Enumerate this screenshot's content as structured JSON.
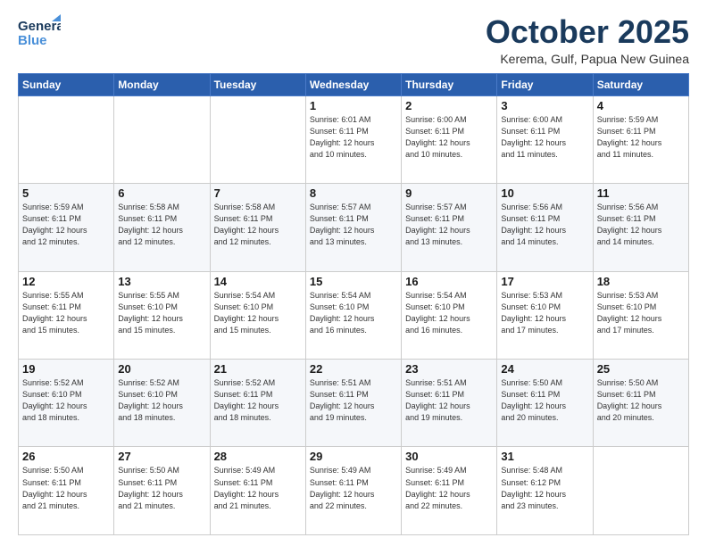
{
  "header": {
    "logo_line1": "General",
    "logo_line2": "Blue",
    "month": "October 2025",
    "location": "Kerema, Gulf, Papua New Guinea"
  },
  "weekdays": [
    "Sunday",
    "Monday",
    "Tuesday",
    "Wednesday",
    "Thursday",
    "Friday",
    "Saturday"
  ],
  "weeks": [
    [
      {
        "day": "",
        "info": ""
      },
      {
        "day": "",
        "info": ""
      },
      {
        "day": "",
        "info": ""
      },
      {
        "day": "1",
        "info": "Sunrise: 6:01 AM\nSunset: 6:11 PM\nDaylight: 12 hours\nand 10 minutes."
      },
      {
        "day": "2",
        "info": "Sunrise: 6:00 AM\nSunset: 6:11 PM\nDaylight: 12 hours\nand 10 minutes."
      },
      {
        "day": "3",
        "info": "Sunrise: 6:00 AM\nSunset: 6:11 PM\nDaylight: 12 hours\nand 11 minutes."
      },
      {
        "day": "4",
        "info": "Sunrise: 5:59 AM\nSunset: 6:11 PM\nDaylight: 12 hours\nand 11 minutes."
      }
    ],
    [
      {
        "day": "5",
        "info": "Sunrise: 5:59 AM\nSunset: 6:11 PM\nDaylight: 12 hours\nand 12 minutes."
      },
      {
        "day": "6",
        "info": "Sunrise: 5:58 AM\nSunset: 6:11 PM\nDaylight: 12 hours\nand 12 minutes."
      },
      {
        "day": "7",
        "info": "Sunrise: 5:58 AM\nSunset: 6:11 PM\nDaylight: 12 hours\nand 12 minutes."
      },
      {
        "day": "8",
        "info": "Sunrise: 5:57 AM\nSunset: 6:11 PM\nDaylight: 12 hours\nand 13 minutes."
      },
      {
        "day": "9",
        "info": "Sunrise: 5:57 AM\nSunset: 6:11 PM\nDaylight: 12 hours\nand 13 minutes."
      },
      {
        "day": "10",
        "info": "Sunrise: 5:56 AM\nSunset: 6:11 PM\nDaylight: 12 hours\nand 14 minutes."
      },
      {
        "day": "11",
        "info": "Sunrise: 5:56 AM\nSunset: 6:11 PM\nDaylight: 12 hours\nand 14 minutes."
      }
    ],
    [
      {
        "day": "12",
        "info": "Sunrise: 5:55 AM\nSunset: 6:11 PM\nDaylight: 12 hours\nand 15 minutes."
      },
      {
        "day": "13",
        "info": "Sunrise: 5:55 AM\nSunset: 6:10 PM\nDaylight: 12 hours\nand 15 minutes."
      },
      {
        "day": "14",
        "info": "Sunrise: 5:54 AM\nSunset: 6:10 PM\nDaylight: 12 hours\nand 15 minutes."
      },
      {
        "day": "15",
        "info": "Sunrise: 5:54 AM\nSunset: 6:10 PM\nDaylight: 12 hours\nand 16 minutes."
      },
      {
        "day": "16",
        "info": "Sunrise: 5:54 AM\nSunset: 6:10 PM\nDaylight: 12 hours\nand 16 minutes."
      },
      {
        "day": "17",
        "info": "Sunrise: 5:53 AM\nSunset: 6:10 PM\nDaylight: 12 hours\nand 17 minutes."
      },
      {
        "day": "18",
        "info": "Sunrise: 5:53 AM\nSunset: 6:10 PM\nDaylight: 12 hours\nand 17 minutes."
      }
    ],
    [
      {
        "day": "19",
        "info": "Sunrise: 5:52 AM\nSunset: 6:10 PM\nDaylight: 12 hours\nand 18 minutes."
      },
      {
        "day": "20",
        "info": "Sunrise: 5:52 AM\nSunset: 6:10 PM\nDaylight: 12 hours\nand 18 minutes."
      },
      {
        "day": "21",
        "info": "Sunrise: 5:52 AM\nSunset: 6:11 PM\nDaylight: 12 hours\nand 18 minutes."
      },
      {
        "day": "22",
        "info": "Sunrise: 5:51 AM\nSunset: 6:11 PM\nDaylight: 12 hours\nand 19 minutes."
      },
      {
        "day": "23",
        "info": "Sunrise: 5:51 AM\nSunset: 6:11 PM\nDaylight: 12 hours\nand 19 minutes."
      },
      {
        "day": "24",
        "info": "Sunrise: 5:50 AM\nSunset: 6:11 PM\nDaylight: 12 hours\nand 20 minutes."
      },
      {
        "day": "25",
        "info": "Sunrise: 5:50 AM\nSunset: 6:11 PM\nDaylight: 12 hours\nand 20 minutes."
      }
    ],
    [
      {
        "day": "26",
        "info": "Sunrise: 5:50 AM\nSunset: 6:11 PM\nDaylight: 12 hours\nand 21 minutes."
      },
      {
        "day": "27",
        "info": "Sunrise: 5:50 AM\nSunset: 6:11 PM\nDaylight: 12 hours\nand 21 minutes."
      },
      {
        "day": "28",
        "info": "Sunrise: 5:49 AM\nSunset: 6:11 PM\nDaylight: 12 hours\nand 21 minutes."
      },
      {
        "day": "29",
        "info": "Sunrise: 5:49 AM\nSunset: 6:11 PM\nDaylight: 12 hours\nand 22 minutes."
      },
      {
        "day": "30",
        "info": "Sunrise: 5:49 AM\nSunset: 6:11 PM\nDaylight: 12 hours\nand 22 minutes."
      },
      {
        "day": "31",
        "info": "Sunrise: 5:48 AM\nSunset: 6:12 PM\nDaylight: 12 hours\nand 23 minutes."
      },
      {
        "day": "",
        "info": ""
      }
    ]
  ]
}
